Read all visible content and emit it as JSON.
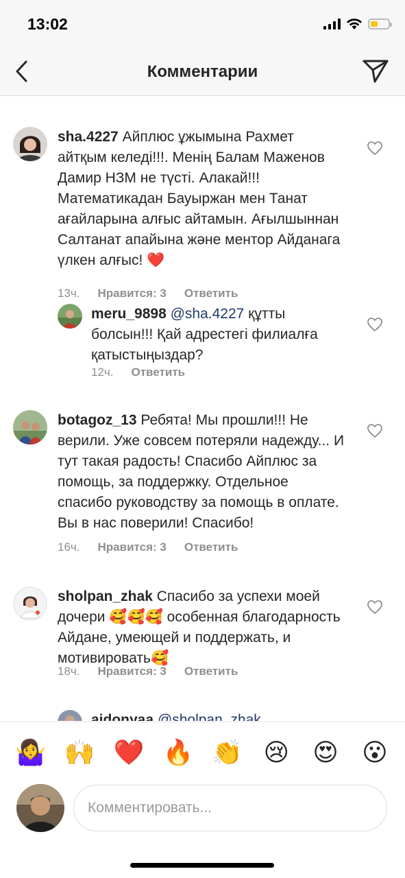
{
  "status": {
    "time": "13:02"
  },
  "header": {
    "title": "Комментарии"
  },
  "comments": [
    {
      "username": "sha.4227",
      "text": "Айплюс ұжымына Рахмет айтқым келеді!!!. Менің Балам Маженов Дамир НЗМ не түсті. Алакай!!! Математикадан Бауыржан мен Танат ағайларына алғыс айтамын. Ағылшыннан Салтанат апайына және ментор Айданага үлкен алғыс!",
      "emoji": "❤️",
      "time": "13ч.",
      "likes": "Нравится: 3",
      "reply": "Ответить"
    },
    {
      "username": "meru_9898",
      "mention": "@sha.4227",
      "text": "құтты болсын!!! Қай адрестегі филиалға қатыстыңыздар?",
      "time": "12ч.",
      "reply": "Ответить"
    },
    {
      "username": "botagoz_13",
      "text": "Ребята!  Мы прошли!!! Не верили. Уже совсем потеряли надежду... И тут такая радость! Спасибо Айплюс за помощь, за поддержку. Отдельное спасибо руководству за помощь в оплате. Вы в нас поверили!  Спасибо!",
      "time": "16ч.",
      "likes": "Нравится: 3",
      "reply": "Ответить"
    },
    {
      "username": "sholpan_zhak",
      "text_before": "Спасибо за успехи моей дочери",
      "emoji_mid": "🥰🥰🥰",
      "text_after": "особенная благодарность Айдане, умеющей и поддержать, и мотивировать",
      "emoji_end": "🥰",
      "time": "18ч.",
      "likes": "Нравится: 3",
      "reply": "Ответить"
    },
    {
      "username": "aidonyaa",
      "mention": "@sholpan_zhak"
    }
  ],
  "emoji_bar": [
    "🤷‍♀️",
    "🙌",
    "❤️",
    "🔥",
    "👏",
    "😢",
    "😍",
    "😮"
  ],
  "input": {
    "placeholder": "Комментировать..."
  },
  "colors": {
    "mention": "#1f3a68",
    "meta": "#8e8e8e",
    "battery": "#f5c518"
  }
}
